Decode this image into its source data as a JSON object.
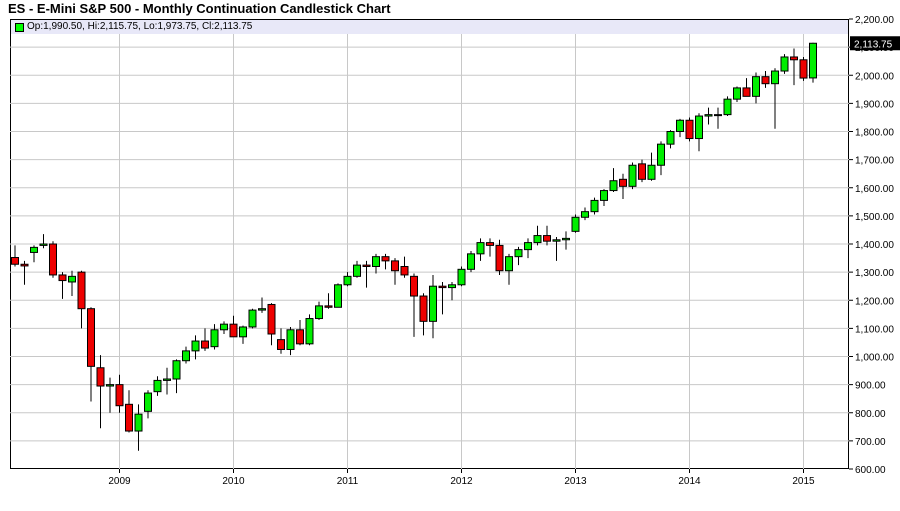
{
  "title": "ES - E-Mini S&P 500 - Monthly Continuation Candlestick Chart",
  "legend": {
    "text": "Op:1,990.50, Hi:2,115.75, Lo:1,973.75, Cl:2,113.75"
  },
  "last_price_label": "2,113.75",
  "colors": {
    "up": "#00ee00",
    "down": "#ee0000",
    "outline": "#000000",
    "grid": "#c8c8c8",
    "last_price_bg": "#000000",
    "legend_bg": "#e8e8f8"
  },
  "chart_data": {
    "type": "candlestick",
    "title": "ES - E-Mini S&P 500 - Monthly Continuation Candlestick Chart",
    "ylim": [
      600,
      2200
    ],
    "y_ticks": [
      "600.00",
      "700.00",
      "800.00",
      "900.00",
      "1,000.00",
      "1,100.00",
      "1,200.00",
      "1,300.00",
      "1,400.00",
      "1,500.00",
      "1,600.00",
      "1,700.00",
      "1,800.00",
      "1,900.00",
      "2,000.00",
      "2,100.00",
      "2,200.00"
    ],
    "y_tick_values": [
      600,
      700,
      800,
      900,
      1000,
      1100,
      1200,
      1300,
      1400,
      1500,
      1600,
      1700,
      1800,
      1900,
      2000,
      2100,
      2200
    ],
    "x_ticks": [
      "2009",
      "2010",
      "2011",
      "2012",
      "2013",
      "2014",
      "2015"
    ],
    "x_tick_dates": [
      "2009-01",
      "2010-01",
      "2011-01",
      "2012-01",
      "2013-01",
      "2014-01",
      "2015-01"
    ],
    "grid": true,
    "candles": [
      {
        "date": "2008-02",
        "open": 1352,
        "high": 1395,
        "low": 1320,
        "close": 1328
      },
      {
        "date": "2008-03",
        "open": 1328,
        "high": 1340,
        "low": 1255,
        "close": 1322
      },
      {
        "date": "2008-04",
        "open": 1370,
        "high": 1395,
        "low": 1335,
        "close": 1388
      },
      {
        "date": "2008-05",
        "open": 1395,
        "high": 1435,
        "low": 1385,
        "close": 1400
      },
      {
        "date": "2008-06",
        "open": 1400,
        "high": 1410,
        "low": 1280,
        "close": 1290
      },
      {
        "date": "2008-07",
        "open": 1290,
        "high": 1300,
        "low": 1205,
        "close": 1270
      },
      {
        "date": "2008-08",
        "open": 1265,
        "high": 1305,
        "low": 1215,
        "close": 1285
      },
      {
        "date": "2008-09",
        "open": 1300,
        "high": 1305,
        "low": 1100,
        "close": 1170
      },
      {
        "date": "2008-10",
        "open": 1170,
        "high": 1175,
        "low": 840,
        "close": 965
      },
      {
        "date": "2008-11",
        "open": 960,
        "high": 1005,
        "low": 745,
        "close": 895
      },
      {
        "date": "2008-12",
        "open": 895,
        "high": 925,
        "low": 800,
        "close": 900
      },
      {
        "date": "2009-01",
        "open": 900,
        "high": 935,
        "low": 800,
        "close": 825
      },
      {
        "date": "2009-02",
        "open": 830,
        "high": 880,
        "low": 730,
        "close": 735
      },
      {
        "date": "2009-03",
        "open": 735,
        "high": 830,
        "low": 665,
        "close": 795
      },
      {
        "date": "2009-04",
        "open": 805,
        "high": 880,
        "low": 780,
        "close": 870
      },
      {
        "date": "2009-05",
        "open": 875,
        "high": 930,
        "low": 860,
        "close": 915
      },
      {
        "date": "2009-06",
        "open": 915,
        "high": 960,
        "low": 865,
        "close": 920
      },
      {
        "date": "2009-07",
        "open": 920,
        "high": 990,
        "low": 870,
        "close": 985
      },
      {
        "date": "2009-08",
        "open": 985,
        "high": 1035,
        "low": 975,
        "close": 1020
      },
      {
        "date": "2009-09",
        "open": 1020,
        "high": 1075,
        "low": 990,
        "close": 1055
      },
      {
        "date": "2009-10",
        "open": 1055,
        "high": 1100,
        "low": 1020,
        "close": 1030
      },
      {
        "date": "2009-11",
        "open": 1035,
        "high": 1115,
        "low": 1025,
        "close": 1095
      },
      {
        "date": "2009-12",
        "open": 1095,
        "high": 1125,
        "low": 1080,
        "close": 1115
      },
      {
        "date": "2010-01",
        "open": 1115,
        "high": 1145,
        "low": 1070,
        "close": 1070
      },
      {
        "date": "2010-02",
        "open": 1070,
        "high": 1110,
        "low": 1045,
        "close": 1105
      },
      {
        "date": "2010-03",
        "open": 1105,
        "high": 1170,
        "low": 1100,
        "close": 1165
      },
      {
        "date": "2010-04",
        "open": 1165,
        "high": 1210,
        "low": 1155,
        "close": 1170
      },
      {
        "date": "2010-05",
        "open": 1185,
        "high": 1190,
        "low": 1040,
        "close": 1080
      },
      {
        "date": "2010-06",
        "open": 1060,
        "high": 1100,
        "low": 1010,
        "close": 1025
      },
      {
        "date": "2010-07",
        "open": 1025,
        "high": 1105,
        "low": 1005,
        "close": 1095
      },
      {
        "date": "2010-08",
        "open": 1095,
        "high": 1130,
        "low": 1040,
        "close": 1045
      },
      {
        "date": "2010-09",
        "open": 1045,
        "high": 1150,
        "low": 1040,
        "close": 1135
      },
      {
        "date": "2010-10",
        "open": 1135,
        "high": 1195,
        "low": 1130,
        "close": 1180
      },
      {
        "date": "2010-11",
        "open": 1180,
        "high": 1225,
        "low": 1170,
        "close": 1175
      },
      {
        "date": "2010-12",
        "open": 1175,
        "high": 1260,
        "low": 1175,
        "close": 1255
      },
      {
        "date": "2011-01",
        "open": 1255,
        "high": 1300,
        "low": 1250,
        "close": 1285
      },
      {
        "date": "2011-02",
        "open": 1285,
        "high": 1340,
        "low": 1280,
        "close": 1325
      },
      {
        "date": "2011-03",
        "open": 1325,
        "high": 1340,
        "low": 1245,
        "close": 1320
      },
      {
        "date": "2011-04",
        "open": 1320,
        "high": 1365,
        "low": 1295,
        "close": 1355
      },
      {
        "date": "2011-05",
        "open": 1355,
        "high": 1365,
        "low": 1310,
        "close": 1340
      },
      {
        "date": "2011-06",
        "open": 1340,
        "high": 1350,
        "low": 1255,
        "close": 1305
      },
      {
        "date": "2011-07",
        "open": 1320,
        "high": 1355,
        "low": 1280,
        "close": 1290
      },
      {
        "date": "2011-08",
        "open": 1285,
        "high": 1295,
        "low": 1070,
        "close": 1215
      },
      {
        "date": "2011-09",
        "open": 1215,
        "high": 1225,
        "low": 1075,
        "close": 1125
      },
      {
        "date": "2011-10",
        "open": 1125,
        "high": 1290,
        "low": 1065,
        "close": 1250
      },
      {
        "date": "2011-11",
        "open": 1250,
        "high": 1265,
        "low": 1150,
        "close": 1245
      },
      {
        "date": "2011-12",
        "open": 1245,
        "high": 1265,
        "low": 1200,
        "close": 1255
      },
      {
        "date": "2012-01",
        "open": 1255,
        "high": 1320,
        "low": 1250,
        "close": 1310
      },
      {
        "date": "2012-02",
        "open": 1310,
        "high": 1375,
        "low": 1300,
        "close": 1365
      },
      {
        "date": "2012-03",
        "open": 1365,
        "high": 1420,
        "low": 1340,
        "close": 1405
      },
      {
        "date": "2012-04",
        "open": 1405,
        "high": 1420,
        "low": 1355,
        "close": 1395
      },
      {
        "date": "2012-05",
        "open": 1395,
        "high": 1415,
        "low": 1290,
        "close": 1305
      },
      {
        "date": "2012-06",
        "open": 1305,
        "high": 1365,
        "low": 1255,
        "close": 1355
      },
      {
        "date": "2012-07",
        "open": 1355,
        "high": 1390,
        "low": 1325,
        "close": 1380
      },
      {
        "date": "2012-08",
        "open": 1380,
        "high": 1420,
        "low": 1350,
        "close": 1405
      },
      {
        "date": "2012-09",
        "open": 1405,
        "high": 1465,
        "low": 1395,
        "close": 1430
      },
      {
        "date": "2012-10",
        "open": 1430,
        "high": 1465,
        "low": 1395,
        "close": 1410
      },
      {
        "date": "2012-11",
        "open": 1410,
        "high": 1425,
        "low": 1340,
        "close": 1415
      },
      {
        "date": "2012-12",
        "open": 1415,
        "high": 1445,
        "low": 1380,
        "close": 1420
      },
      {
        "date": "2013-01",
        "open": 1445,
        "high": 1505,
        "low": 1440,
        "close": 1495
      },
      {
        "date": "2013-02",
        "open": 1495,
        "high": 1530,
        "low": 1485,
        "close": 1515
      },
      {
        "date": "2013-03",
        "open": 1515,
        "high": 1565,
        "low": 1505,
        "close": 1555
      },
      {
        "date": "2013-04",
        "open": 1555,
        "high": 1595,
        "low": 1535,
        "close": 1590
      },
      {
        "date": "2013-05",
        "open": 1590,
        "high": 1670,
        "low": 1585,
        "close": 1625
      },
      {
        "date": "2013-06",
        "open": 1630,
        "high": 1650,
        "low": 1560,
        "close": 1605
      },
      {
        "date": "2013-07",
        "open": 1605,
        "high": 1690,
        "low": 1595,
        "close": 1680
      },
      {
        "date": "2013-08",
        "open": 1685,
        "high": 1700,
        "low": 1620,
        "close": 1630
      },
      {
        "date": "2013-09",
        "open": 1630,
        "high": 1725,
        "low": 1625,
        "close": 1680
      },
      {
        "date": "2013-10",
        "open": 1680,
        "high": 1765,
        "low": 1645,
        "close": 1755
      },
      {
        "date": "2013-11",
        "open": 1755,
        "high": 1805,
        "low": 1740,
        "close": 1800
      },
      {
        "date": "2013-12",
        "open": 1800,
        "high": 1845,
        "low": 1780,
        "close": 1840
      },
      {
        "date": "2014-01",
        "open": 1840,
        "high": 1850,
        "low": 1765,
        "close": 1775
      },
      {
        "date": "2014-02",
        "open": 1775,
        "high": 1865,
        "low": 1730,
        "close": 1855
      },
      {
        "date": "2014-03",
        "open": 1855,
        "high": 1885,
        "low": 1825,
        "close": 1860
      },
      {
        "date": "2014-04",
        "open": 1860,
        "high": 1885,
        "low": 1810,
        "close": 1860
      },
      {
        "date": "2014-05",
        "open": 1860,
        "high": 1925,
        "low": 1855,
        "close": 1915
      },
      {
        "date": "2014-06",
        "open": 1915,
        "high": 1960,
        "low": 1905,
        "close": 1955
      },
      {
        "date": "2014-07",
        "open": 1955,
        "high": 1990,
        "low": 1925,
        "close": 1925
      },
      {
        "date": "2014-08",
        "open": 1925,
        "high": 2010,
        "low": 1900,
        "close": 1995
      },
      {
        "date": "2014-09",
        "open": 1995,
        "high": 2015,
        "low": 1955,
        "close": 1970
      },
      {
        "date": "2014-10",
        "open": 1970,
        "high": 2025,
        "low": 1810,
        "close": 2015
      },
      {
        "date": "2014-11",
        "open": 2015,
        "high": 2075,
        "low": 2005,
        "close": 2065
      },
      {
        "date": "2014-12",
        "open": 2065,
        "high": 2095,
        "low": 1965,
        "close": 2055
      },
      {
        "date": "2015-01",
        "open": 2055,
        "high": 2065,
        "low": 1980,
        "close": 1990
      },
      {
        "date": "2015-02",
        "open": 1990.5,
        "high": 2115.75,
        "low": 1973.75,
        "close": 2113.75
      }
    ]
  }
}
